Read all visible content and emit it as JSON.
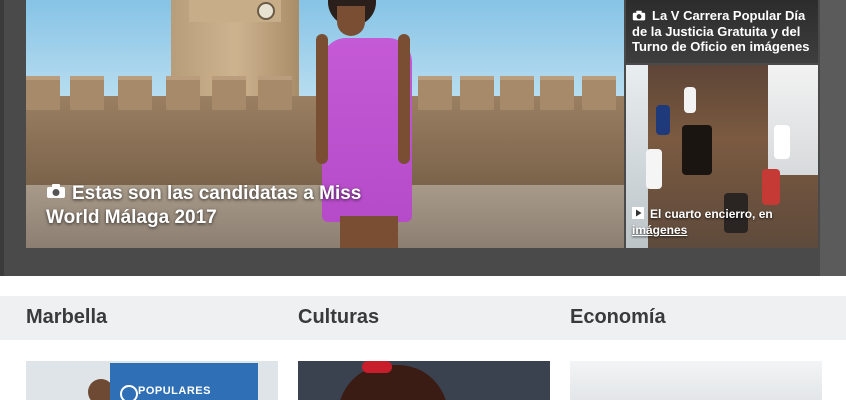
{
  "hero": {
    "main": {
      "title": "Estas son las candidatas a Miss World Málaga 2017",
      "icon": "camera-icon"
    },
    "side_top": {
      "title": "La V Carrera Popular Día de la Justicia Gratuita y del Turno de Oficio en imágenes",
      "icon": "camera-icon"
    },
    "side_bottom": {
      "title_part1": "El cuarto encierro, en",
      "title_part2": "imágenes",
      "icon": "play-icon"
    }
  },
  "sections": [
    {
      "label": "Marbella"
    },
    {
      "label": "Culturas"
    },
    {
      "label": "Economía"
    }
  ],
  "thumbs": {
    "marbella_banner": "POPULARES"
  },
  "colors": {
    "hero_background": "#4a4a4a",
    "section_bar": "#eef0f2",
    "pp_blue": "#2f6fb6",
    "dress": "#c55ad6"
  }
}
